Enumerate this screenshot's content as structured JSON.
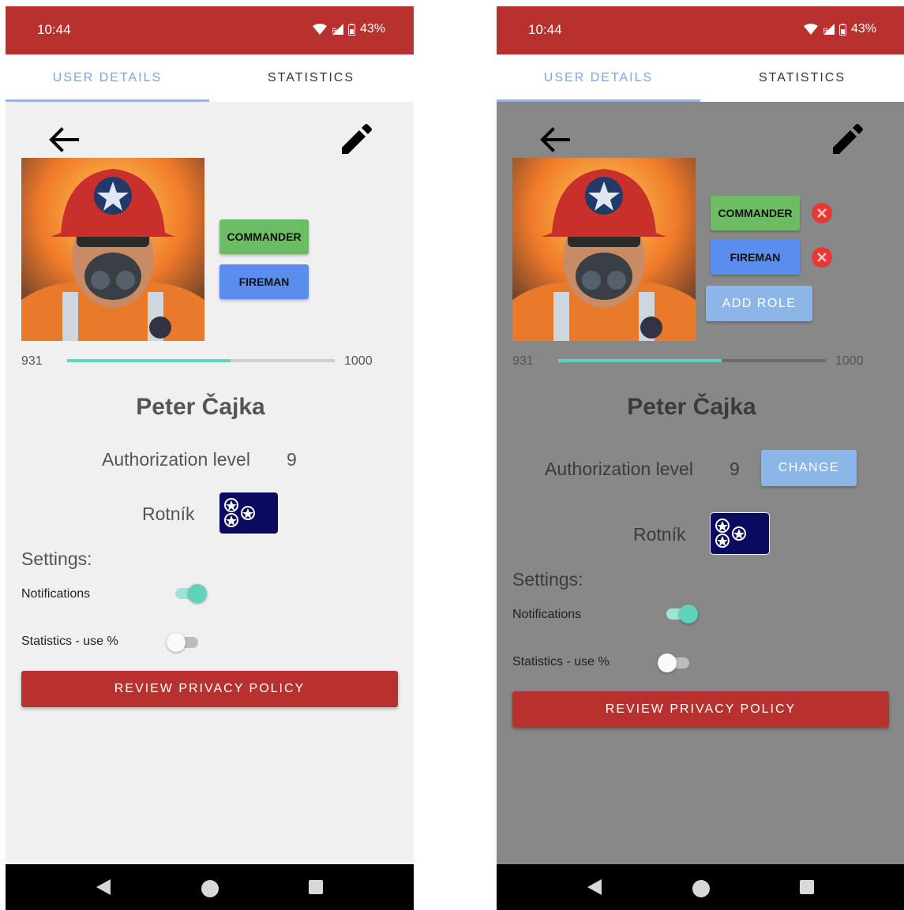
{
  "status_bar": {
    "time": "10:44",
    "battery": "43%",
    "signal_sub": "R"
  },
  "tabs": [
    {
      "label": "USER DETAILS",
      "active": true
    },
    {
      "label": "STATISTICS",
      "active": false
    }
  ],
  "left": {
    "roles": [
      "COMMANDER",
      "FIREMAN"
    ],
    "xp": {
      "current": "931",
      "max": "1000",
      "fill_fraction": 0.61
    },
    "user_name": "Peter Čajka",
    "authorization_label": "Authorization level",
    "authorization_value": "9",
    "rank_name": "Rotník",
    "settings_title": "Settings:",
    "settings": [
      {
        "label": "Notifications",
        "enabled": true
      },
      {
        "label": "Statistics - use %",
        "enabled": false
      }
    ],
    "privacy_button": "REVIEW PRIVACY POLICY"
  },
  "right": {
    "roles": [
      "COMMANDER",
      "FIREMAN"
    ],
    "add_role_button": "ADD ROLE",
    "xp": {
      "current": "931",
      "max": "1000",
      "fill_fraction": 0.61
    },
    "user_name": "Peter Čajka",
    "authorization_label": "Authorization level",
    "authorization_value": "9",
    "change_button": "CHANGE",
    "rank_name": "Rotník",
    "settings_title": "Settings:",
    "settings": [
      {
        "label": "Notifications",
        "enabled": true
      },
      {
        "label": "Statistics - use %",
        "enabled": false
      }
    ],
    "privacy_button": "REVIEW PRIVACY POLICY"
  },
  "icons": {
    "back": "arrow-back-icon",
    "edit": "pencil-icon",
    "remove": "close-circle-icon",
    "nav": [
      "back-triangle-icon",
      "home-circle-icon",
      "recents-square-icon"
    ]
  },
  "colors": {
    "brand_red": "#b7312e",
    "tab_active": "#7aa6da",
    "accent_teal": "#5fd3bc",
    "role_green": "#6cbc63",
    "role_blue": "#5b8def",
    "rank_badge": "#0a0a5e"
  }
}
